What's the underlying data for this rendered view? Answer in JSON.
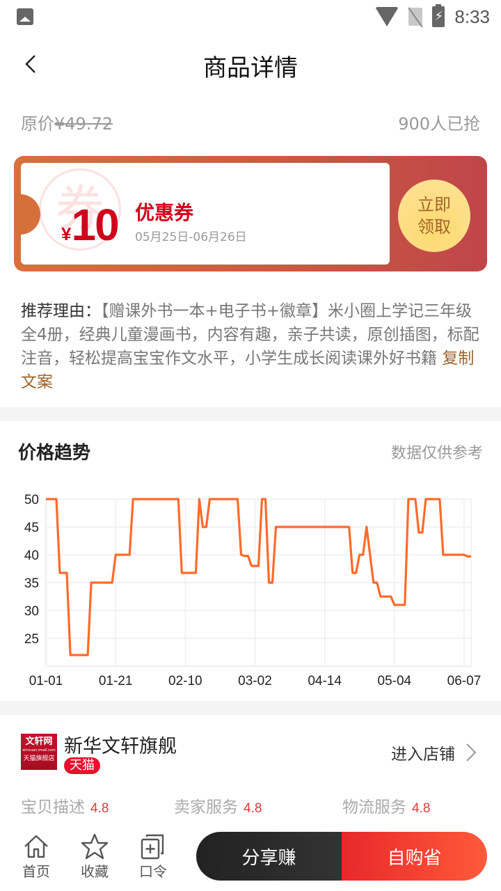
{
  "status_bar": {
    "time": "8:33",
    "icons": [
      "image-icon",
      "wifi-icon",
      "no-sim-icon",
      "battery-charging-icon"
    ]
  },
  "header": {
    "title": "商品详情",
    "back_icon": "chevron-left-icon"
  },
  "price": {
    "original_label": "原价",
    "original_value": "¥49.72",
    "grabbed": "900人已抢"
  },
  "coupon": {
    "stamp": "券",
    "currency": "¥",
    "amount": "10",
    "name": "优惠券",
    "validity": "05月25日-06月26日",
    "claim_line1": "立即",
    "claim_line2": "领取",
    "colors": {
      "start": "#d8703c",
      "end": "#c0454a",
      "accent": "#d0021b",
      "button": "#fde39a"
    }
  },
  "reason": {
    "label": "推荐理由：",
    "text": "【赠课外书一本+电子书+徽章】米小圈上学记三年级全4册，经典儿童漫画书，内容有趣，亲子共读，原创插图，标配注音，轻松提高宝宝作文水平，小学生成长阅读课外好书籍",
    "copy_link": "复制文案"
  },
  "trend": {
    "title": "价格趋势",
    "note": "数据仅供参考"
  },
  "chart_data": {
    "type": "line",
    "title": "价格趋势",
    "xlabel": "",
    "ylabel": "",
    "ylim": [
      20,
      50
    ],
    "xlim": [
      0,
      122
    ],
    "yticks": [
      25,
      30,
      35,
      40,
      45,
      50
    ],
    "xticks": [
      {
        "idx": 0,
        "label": "01-01"
      },
      {
        "idx": 20,
        "label": "01-21"
      },
      {
        "idx": 40,
        "label": "02-10"
      },
      {
        "idx": 60,
        "label": "03-02"
      },
      {
        "idx": 80,
        "label": "04-14"
      },
      {
        "idx": 100,
        "label": "05-04"
      },
      {
        "idx": 120,
        "label": "06-07"
      }
    ],
    "grid": true,
    "color": "#ff6a2a",
    "series": [
      {
        "name": "价格",
        "points": [
          [
            0,
            50
          ],
          [
            3,
            50
          ],
          [
            4,
            36.75
          ],
          [
            6,
            36.75
          ],
          [
            7,
            22
          ],
          [
            12,
            22
          ],
          [
            13,
            35
          ],
          [
            19,
            35
          ],
          [
            20,
            40
          ],
          [
            24,
            40
          ],
          [
            25,
            50
          ],
          [
            38,
            50
          ],
          [
            39,
            36.75
          ],
          [
            43,
            36.75
          ],
          [
            44,
            50
          ],
          [
            45,
            45
          ],
          [
            46,
            45
          ],
          [
            47,
            50
          ],
          [
            55,
            50
          ],
          [
            56,
            40
          ],
          [
            57,
            39.8
          ],
          [
            58,
            39.8
          ],
          [
            59,
            38
          ],
          [
            61,
            38
          ],
          [
            62,
            50
          ],
          [
            63,
            50
          ],
          [
            64,
            35
          ],
          [
            65,
            35
          ],
          [
            66,
            45
          ],
          [
            87,
            45
          ],
          [
            88,
            36.75
          ],
          [
            89,
            36.75
          ],
          [
            90,
            40
          ],
          [
            91,
            40
          ],
          [
            92,
            45
          ],
          [
            94,
            35
          ],
          [
            95,
            35
          ],
          [
            96,
            32.5
          ],
          [
            99,
            32.5
          ],
          [
            100,
            31
          ],
          [
            103,
            31
          ],
          [
            104,
            50
          ],
          [
            106,
            50
          ],
          [
            107,
            44
          ],
          [
            108,
            44
          ],
          [
            109,
            50
          ],
          [
            113,
            50
          ],
          [
            114,
            40
          ],
          [
            120,
            40
          ],
          [
            121,
            39.7
          ],
          [
            122,
            39.7
          ]
        ]
      }
    ]
  },
  "shop": {
    "logo_line1": "文轩网",
    "logo_line2": "winxuan.tmall.com",
    "logo_line3": "天猫旗舰店",
    "name": "新华文轩旗舰",
    "badge": "天猫",
    "enter_label": "进入店铺",
    "scores": [
      {
        "label": "宝贝描述",
        "value": "4.8"
      },
      {
        "label": "卖家服务",
        "value": "4.8"
      },
      {
        "label": "物流服务",
        "value": "4.8"
      }
    ]
  },
  "bottom_bar": {
    "nav": [
      {
        "label": "首页",
        "icon": "home-icon"
      },
      {
        "label": "收藏",
        "icon": "star-icon"
      },
      {
        "label": "口令",
        "icon": "copy-add-icon"
      }
    ],
    "share_label": "分享赚",
    "buy_label": "自购省"
  }
}
